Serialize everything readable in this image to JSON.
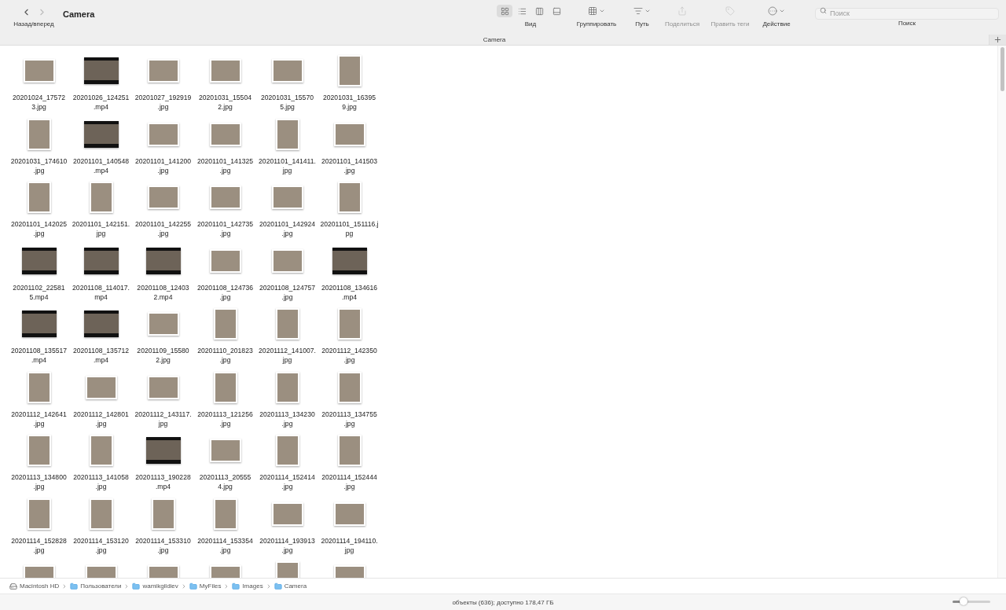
{
  "window": {
    "title": "Camera"
  },
  "toolbar": {
    "nav_label": "Назад/вперед",
    "back_disabled": false,
    "forward_disabled": true,
    "view": {
      "label": "Вид",
      "modes": [
        {
          "kind": "icons",
          "selected": true
        },
        {
          "kind": "list",
          "selected": false
        },
        {
          "kind": "columns",
          "selected": false
        },
        {
          "kind": "gallery",
          "selected": false
        }
      ]
    },
    "items": [
      {
        "kind": "group",
        "label": "Группировать",
        "disabled": false
      },
      {
        "kind": "path",
        "label": "Путь",
        "disabled": false
      },
      {
        "kind": "share",
        "label": "Поделиться",
        "disabled": true
      },
      {
        "kind": "tags",
        "label": "Править теги",
        "disabled": true
      },
      {
        "kind": "action",
        "label": "Действие",
        "disabled": false
      }
    ],
    "search": {
      "placeholder": "Поиск",
      "label": "Поиск"
    }
  },
  "tab_bar": {
    "title": "Camera"
  },
  "files": [
    {
      "kind": "photo_landscape",
      "lines": [
        "20201024_17572",
        "3.jpg"
      ]
    },
    {
      "kind": "video",
      "lines": [
        "20201026_124251",
        ".mp4"
      ]
    },
    {
      "kind": "photo_landscape",
      "lines": [
        "20201027_192919",
        ".jpg"
      ]
    },
    {
      "kind": "photo_landscape",
      "lines": [
        "20201031_15504",
        "2.jpg"
      ]
    },
    {
      "kind": "photo_landscape",
      "lines": [
        "20201031_15570",
        "5.jpg"
      ]
    },
    {
      "kind": "photo_portrait",
      "lines": [
        "20201031_16395",
        "9.jpg"
      ]
    },
    {
      "kind": "photo_portrait",
      "lines": [
        "20201031_174610",
        ".jpg"
      ]
    },
    {
      "kind": "video",
      "lines": [
        "20201101_140548",
        ".mp4"
      ]
    },
    {
      "kind": "photo_landscape",
      "lines": [
        "20201101_141200",
        ".jpg"
      ]
    },
    {
      "kind": "photo_landscape",
      "lines": [
        "20201101_141325",
        ".jpg"
      ]
    },
    {
      "kind": "photo_portrait",
      "lines": [
        "20201101_141411.",
        "jpg"
      ]
    },
    {
      "kind": "photo_landscape",
      "lines": [
        "20201101_141503",
        ".jpg"
      ]
    },
    {
      "kind": "photo_portrait",
      "lines": [
        "20201101_142025",
        ".jpg"
      ]
    },
    {
      "kind": "photo_portrait",
      "lines": [
        "20201101_142151.",
        "jpg"
      ]
    },
    {
      "kind": "photo_landscape",
      "lines": [
        "20201101_142255",
        ".jpg"
      ]
    },
    {
      "kind": "photo_landscape",
      "lines": [
        "20201101_142735",
        ".jpg"
      ]
    },
    {
      "kind": "photo_landscape",
      "lines": [
        "20201101_142924",
        ".jpg"
      ]
    },
    {
      "kind": "photo_portrait",
      "lines": [
        "20201101_151116.j",
        "pg"
      ]
    },
    {
      "kind": "video",
      "lines": [
        "20201102_22581",
        "5.mp4"
      ]
    },
    {
      "kind": "video",
      "lines": [
        "20201108_114017.",
        "mp4"
      ]
    },
    {
      "kind": "video",
      "lines": [
        "20201108_12403",
        "2.mp4"
      ]
    },
    {
      "kind": "photo_landscape",
      "lines": [
        "20201108_124736",
        ".jpg"
      ]
    },
    {
      "kind": "photo_landscape",
      "lines": [
        "20201108_124757",
        ".jpg"
      ]
    },
    {
      "kind": "video",
      "lines": [
        "20201108_134616",
        ".mp4"
      ]
    },
    {
      "kind": "video",
      "lines": [
        "20201108_135517",
        ".mp4"
      ]
    },
    {
      "kind": "video",
      "lines": [
        "20201108_135712",
        ".mp4"
      ]
    },
    {
      "kind": "photo_landscape",
      "lines": [
        "20201109_15580",
        "2.jpg"
      ]
    },
    {
      "kind": "photo_portrait",
      "lines": [
        "20201110_201823",
        ".jpg"
      ]
    },
    {
      "kind": "photo_portrait",
      "lines": [
        "20201112_141007.",
        "jpg"
      ]
    },
    {
      "kind": "photo_portrait",
      "lines": [
        "20201112_142350",
        ".jpg"
      ]
    },
    {
      "kind": "photo_portrait",
      "lines": [
        "20201112_142641",
        ".jpg"
      ]
    },
    {
      "kind": "photo_landscape",
      "lines": [
        "20201112_142801",
        ".jpg"
      ]
    },
    {
      "kind": "photo_landscape",
      "lines": [
        "20201112_143117.",
        "jpg"
      ]
    },
    {
      "kind": "photo_portrait",
      "lines": [
        "20201113_121256",
        ".jpg"
      ]
    },
    {
      "kind": "photo_portrait",
      "lines": [
        "20201113_134230",
        ".jpg"
      ]
    },
    {
      "kind": "photo_portrait",
      "lines": [
        "20201113_134755",
        ".jpg"
      ]
    },
    {
      "kind": "photo_portrait",
      "lines": [
        "20201113_134800",
        ".jpg"
      ]
    },
    {
      "kind": "photo_portrait",
      "lines": [
        "20201113_141058",
        ".jpg"
      ]
    },
    {
      "kind": "video",
      "lines": [
        "20201113_190228",
        ".mp4"
      ]
    },
    {
      "kind": "photo_landscape",
      "lines": [
        "20201113_20555",
        "4.jpg"
      ]
    },
    {
      "kind": "photo_portrait",
      "lines": [
        "20201114_152414",
        ".jpg"
      ]
    },
    {
      "kind": "photo_portrait",
      "lines": [
        "20201114_152444",
        ".jpg"
      ]
    },
    {
      "kind": "photo_portrait",
      "lines": [
        "20201114_152828",
        ".jpg"
      ]
    },
    {
      "kind": "photo_portrait",
      "lines": [
        "20201114_153120",
        ".jpg"
      ]
    },
    {
      "kind": "photo_portrait",
      "lines": [
        "20201114_153310",
        ".jpg"
      ]
    },
    {
      "kind": "photo_portrait",
      "lines": [
        "20201114_153354",
        ".jpg"
      ]
    },
    {
      "kind": "photo_landscape",
      "lines": [
        "20201114_193913",
        ".jpg"
      ]
    },
    {
      "kind": "photo_landscape",
      "lines": [
        "20201114_194110.",
        "jpg"
      ]
    },
    {
      "kind": "photo_landscape"
    },
    {
      "kind": "photo_landscape"
    },
    {
      "kind": "photo_landscape"
    },
    {
      "kind": "photo_landscape"
    },
    {
      "kind": "photo_portrait"
    },
    {
      "kind": "photo_landscape"
    }
  ],
  "path_bar": [
    {
      "kind": "disk",
      "label": "Macintosh HD"
    },
    {
      "kind": "folder",
      "label": "Пользователи"
    },
    {
      "kind": "folder",
      "label": "wamikgildiev"
    },
    {
      "kind": "folder",
      "label": "MyFiles"
    },
    {
      "kind": "folder",
      "label": "Images"
    },
    {
      "kind": "folder",
      "label": "Camera"
    }
  ],
  "status_bar": {
    "text": "объекты (636); доступно 178,47 ГБ",
    "zoom": {
      "level": 0.3
    }
  }
}
